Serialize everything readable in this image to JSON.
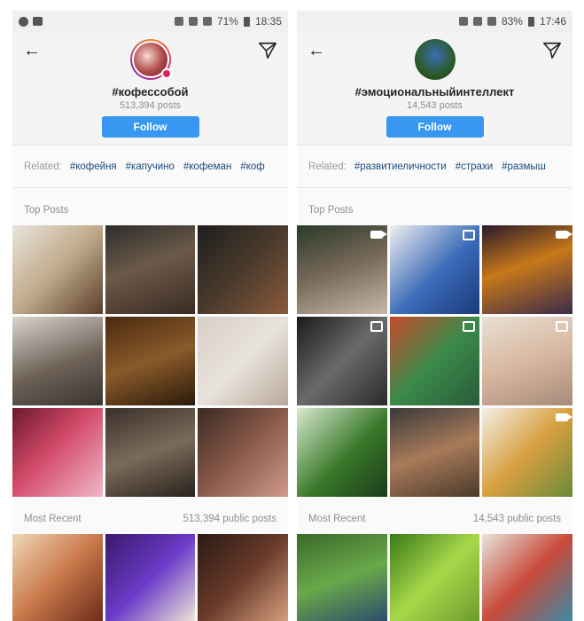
{
  "phones": [
    {
      "status": {
        "battery": "71%",
        "time": "18:35"
      },
      "hashtag": "#кофессобой",
      "posts_count": "513,394 posts",
      "follow_label": "Follow",
      "related_label": "Related:",
      "related_tags": [
        "#кофейня",
        "#капучино",
        "#кофеман",
        "#коф"
      ],
      "top_posts_label": "Top Posts",
      "most_recent_label": "Most Recent",
      "public_posts": "513,394 public posts",
      "colors": {
        "accent": "#3897f0",
        "ring": "#dd2a7b",
        "live": "#e0245e"
      },
      "icons": [
        "back-arrow-icon",
        "send-icon",
        "live-badge-icon"
      ],
      "top_tiles": [
        "linear-gradient(135deg,#e9e4dc,#bfa98a 50%,#5a3e2a)",
        "linear-gradient(160deg,#2d2d2d,#6b5a48 45%,#3b2a22)",
        "linear-gradient(135deg,#1e1e1e,#4a3a2c 50%,#8a5a3a)",
        "linear-gradient(160deg,#d9d4cc,#6e6258 55%,#3a332f)",
        "linear-gradient(160deg,#4a2a10,#8a5a2a 50%,#2a1a0a)",
        "linear-gradient(135deg,#d7cfc6,#e8e2dc 50%,#b8a99a)",
        "linear-gradient(135deg,#6a1a2a,#d24a6a 45%,#f0b8c8)",
        "linear-gradient(160deg,#3a302a,#7a6a5a 50%,#2a221c)",
        "linear-gradient(135deg,#3a2a22,#8a5a4a 50%,#d09a8a)"
      ],
      "recent_tiles": [
        "linear-gradient(135deg,#f0d9b8,#c8784a 50%,#6a2a1a)",
        "linear-gradient(135deg,#3a1a6a,#6a3ac8 50%,#f0e8d8)",
        "linear-gradient(135deg,#2a1a14,#6a3a2a 50%,#d8a080)"
      ]
    },
    {
      "status": {
        "battery": "83%",
        "time": "17:46"
      },
      "hashtag": "#эмоциональныйинтеллект",
      "posts_count": "14,543 posts",
      "follow_label": "Follow",
      "related_label": "Related:",
      "related_tags": [
        "#развитиеличности",
        "#страхи",
        "#размыш"
      ],
      "top_posts_label": "Top Posts",
      "most_recent_label": "Most Recent",
      "public_posts": "14,543 public posts",
      "colors": {
        "accent": "#3897f0"
      },
      "icons": [
        "back-arrow-icon",
        "send-icon"
      ],
      "top_tiles": [
        "linear-gradient(160deg,#2a3a2a,#7a6a5a 50%,#c8b8a8)",
        "linear-gradient(135deg,#f0f0f0,#3a6ab8 55%,#1a3a7a)",
        "linear-gradient(160deg,#2a1a2a,#c8781a 45%,#3a2a4a)",
        "linear-gradient(135deg,#1a1a1a,#6a6a6a 50%,#2a2a2a)",
        "linear-gradient(135deg,#c84a2a,#3a8a4a 50%,#2a5a3a)",
        "linear-gradient(160deg,#e8e0d4,#d8b8a0 50%,#a88a7a)",
        "linear-gradient(135deg,#d8e8d0,#3a7a2a 55%,#1a3a1a)",
        "linear-gradient(160deg,#3a3a3a,#a87a5a 50%,#4a3a2a)",
        "linear-gradient(135deg,#f4f0e8,#d8a040 50%,#6a8a3a)"
      ],
      "recent_tiles": [
        "linear-gradient(160deg,#3a6a2a,#6aa84a 50%,#2a4a6a)",
        "linear-gradient(135deg,#3a7a1a,#a8d84a 50%,#6a9a2a)",
        "linear-gradient(135deg,#e8e4dc,#c84a3a 50%,#3a8aa8)"
      ]
    }
  ]
}
